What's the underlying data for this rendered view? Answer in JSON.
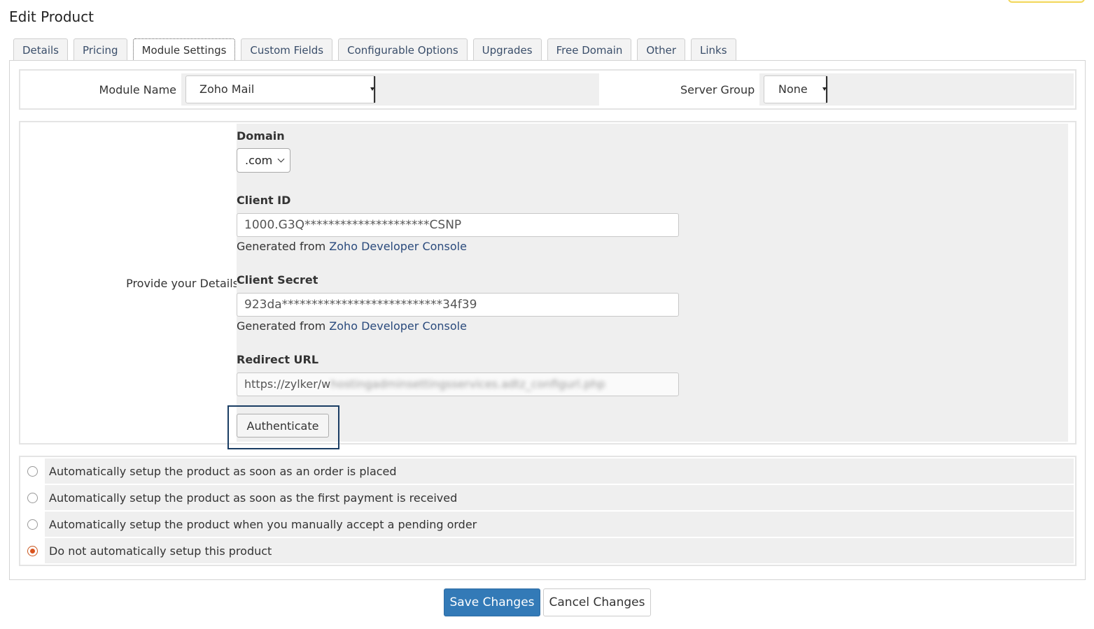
{
  "page": {
    "title": "Edit Product"
  },
  "tabs": [
    {
      "label": "Details"
    },
    {
      "label": "Pricing"
    },
    {
      "label": "Module Settings"
    },
    {
      "label": "Custom Fields"
    },
    {
      "label": "Configurable Options"
    },
    {
      "label": "Upgrades"
    },
    {
      "label": "Free Domain"
    },
    {
      "label": "Other"
    },
    {
      "label": "Links"
    }
  ],
  "active_tab": "Module Settings",
  "module": {
    "name_label": "Module Name",
    "name_value": "Zoho Mail",
    "server_group_label": "Server Group",
    "server_group_value": "None"
  },
  "details": {
    "section_label": "Provide your Details",
    "domain": {
      "label": "Domain",
      "value": ".com"
    },
    "client_id": {
      "label": "Client ID",
      "value": "1000.G3Q*********************CSNP",
      "hint_prefix": "Generated from",
      "hint_link": "Zoho Developer Console"
    },
    "client_secret": {
      "label": "Client Secret",
      "value": "923da***************************34f39",
      "hint_prefix": "Generated from",
      "hint_link": "Zoho Developer Console"
    },
    "redirect_url": {
      "label": "Redirect URL",
      "value_visible": "https://zylker/w",
      "value_blurred": "hostingadminsettingsservices.adtz_configurl.php"
    },
    "authenticate_label": "Authenticate"
  },
  "setup_options": [
    {
      "label": "Automatically setup the product as soon as an order is placed",
      "checked": false
    },
    {
      "label": "Automatically setup the product as soon as the first payment is received",
      "checked": false
    },
    {
      "label": "Automatically setup the product when you manually accept a pending order",
      "checked": false
    },
    {
      "label": "Do not automatically setup this product",
      "checked": true
    }
  ],
  "actions": {
    "save_label": "Save Changes",
    "cancel_label": "Cancel Changes"
  },
  "colors": {
    "primary_button": "#337ab7",
    "link": "#2a4a7c",
    "radio_checked": "#d9531e",
    "highlight_border": "#1a3d63"
  }
}
